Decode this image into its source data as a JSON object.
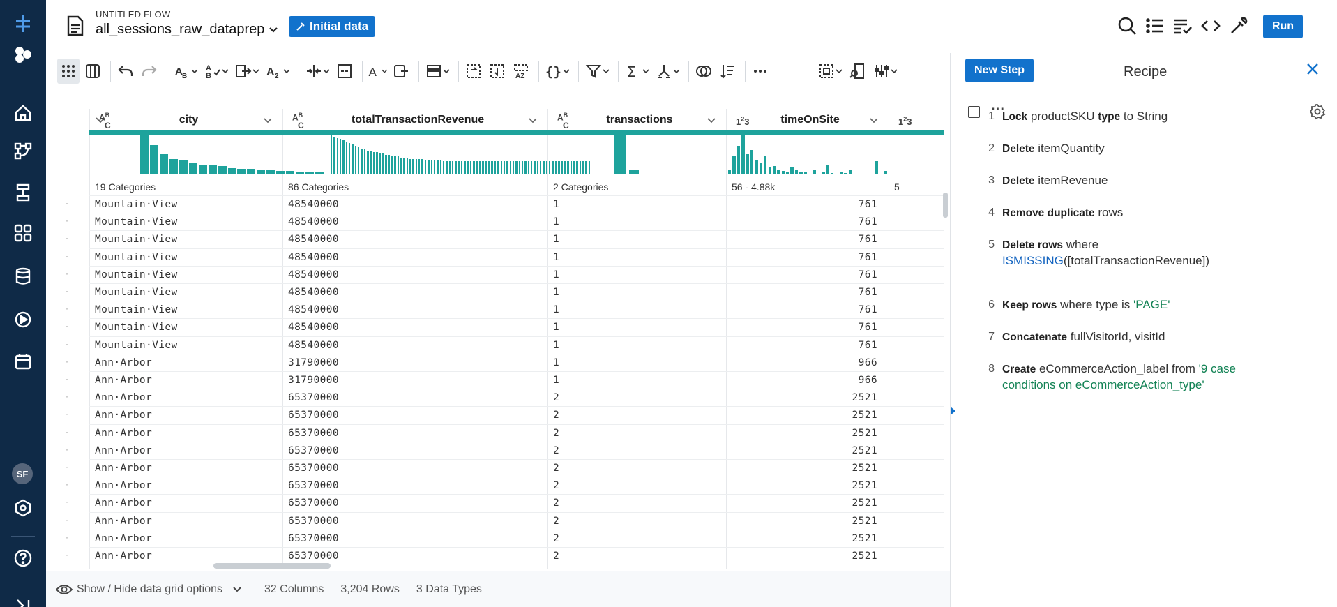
{
  "header": {
    "flow_label": "UNTITLED FLOW",
    "dataset_name": "all_sessions_raw_dataprep",
    "initial_data_label": "Initial data",
    "run_label": "Run"
  },
  "left_nav": {
    "avatar_initials": "SF",
    "icons": [
      "flow-logo-icon",
      "blocks-icon",
      "home-icon",
      "flows-icon",
      "plans-icon",
      "library-icon",
      "database-icon",
      "jobs-icon",
      "schedule-icon",
      "settings-hex-icon",
      "help-icon",
      "collapse-icon"
    ]
  },
  "columns": [
    {
      "type": "ABC",
      "name": "city",
      "summary": "19 Categories"
    },
    {
      "type": "ABC",
      "name": "totalTransactionRevenue",
      "summary": "86 Categories"
    },
    {
      "type": "ABC",
      "name": "transactions",
      "summary": "2 Categories"
    },
    {
      "type": "123",
      "name": "timeOnSite",
      "summary": "56 - 4.88k"
    },
    {
      "type": "123",
      "name": "",
      "summary": "5"
    }
  ],
  "histograms": {
    "city": [
      46,
      32,
      22,
      17,
      15,
      12,
      11,
      10,
      9,
      7,
      6,
      6,
      5,
      5,
      4,
      4,
      3,
      3,
      3
    ],
    "totalTransactionRevenue": [
      32,
      29,
      28,
      27,
      26,
      25,
      24,
      23,
      22,
      21,
      20,
      19,
      18,
      18,
      17,
      17,
      16,
      16,
      15,
      15,
      14,
      14,
      14,
      13,
      13,
      13,
      12,
      12,
      12,
      12,
      12,
      11,
      11,
      11,
      11,
      11,
      11,
      10,
      10,
      10,
      10,
      10,
      10,
      10,
      10,
      10,
      10,
      10,
      10,
      10,
      10,
      10,
      10,
      10,
      10,
      10,
      10,
      10,
      10,
      10,
      10,
      10,
      10,
      10,
      10,
      10,
      10,
      10,
      10,
      10,
      10,
      10,
      10,
      10,
      10,
      10,
      10,
      10,
      10,
      10,
      10,
      10,
      10,
      10,
      10,
      10
    ],
    "transactions": [
      48,
      5
    ],
    "timeOnSite": [
      6,
      26,
      40,
      58,
      28,
      34,
      19,
      16,
      25,
      10,
      12,
      7,
      5,
      3,
      10,
      7,
      4,
      4,
      0,
      6,
      0,
      3,
      13,
      2,
      0,
      3,
      2,
      6,
      0,
      0,
      0,
      0,
      0,
      18,
      0,
      5
    ]
  },
  "rows": [
    {
      "city": "Mountain·View",
      "revenue": "48540000",
      "transactions": "1",
      "timeOnSite": "761"
    },
    {
      "city": "Mountain·View",
      "revenue": "48540000",
      "transactions": "1",
      "timeOnSite": "761"
    },
    {
      "city": "Mountain·View",
      "revenue": "48540000",
      "transactions": "1",
      "timeOnSite": "761"
    },
    {
      "city": "Mountain·View",
      "revenue": "48540000",
      "transactions": "1",
      "timeOnSite": "761"
    },
    {
      "city": "Mountain·View",
      "revenue": "48540000",
      "transactions": "1",
      "timeOnSite": "761"
    },
    {
      "city": "Mountain·View",
      "revenue": "48540000",
      "transactions": "1",
      "timeOnSite": "761"
    },
    {
      "city": "Mountain·View",
      "revenue": "48540000",
      "transactions": "1",
      "timeOnSite": "761"
    },
    {
      "city": "Mountain·View",
      "revenue": "48540000",
      "transactions": "1",
      "timeOnSite": "761"
    },
    {
      "city": "Mountain·View",
      "revenue": "48540000",
      "transactions": "1",
      "timeOnSite": "761"
    },
    {
      "city": "Ann·Arbor",
      "revenue": "31790000",
      "transactions": "1",
      "timeOnSite": "966"
    },
    {
      "city": "Ann·Arbor",
      "revenue": "31790000",
      "transactions": "1",
      "timeOnSite": "966"
    },
    {
      "city": "Ann·Arbor",
      "revenue": "65370000",
      "transactions": "2",
      "timeOnSite": "2521"
    },
    {
      "city": "Ann·Arbor",
      "revenue": "65370000",
      "transactions": "2",
      "timeOnSite": "2521"
    },
    {
      "city": "Ann·Arbor",
      "revenue": "65370000",
      "transactions": "2",
      "timeOnSite": "2521"
    },
    {
      "city": "Ann·Arbor",
      "revenue": "65370000",
      "transactions": "2",
      "timeOnSite": "2521"
    },
    {
      "city": "Ann·Arbor",
      "revenue": "65370000",
      "transactions": "2",
      "timeOnSite": "2521"
    },
    {
      "city": "Ann·Arbor",
      "revenue": "65370000",
      "transactions": "2",
      "timeOnSite": "2521"
    },
    {
      "city": "Ann·Arbor",
      "revenue": "65370000",
      "transactions": "2",
      "timeOnSite": "2521"
    },
    {
      "city": "Ann·Arbor",
      "revenue": "65370000",
      "transactions": "2",
      "timeOnSite": "2521"
    },
    {
      "city": "Ann·Arbor",
      "revenue": "65370000",
      "transactions": "2",
      "timeOnSite": "2521"
    },
    {
      "city": "Ann·Arbor",
      "revenue": "65370000",
      "transactions": "2",
      "timeOnSite": "2521"
    }
  ],
  "footer": {
    "grid_options_label": "Show / Hide data grid options",
    "columns_count": "32 Columns",
    "rows_count": "3,204 Rows",
    "data_types": "3 Data Types"
  },
  "recipe": {
    "new_step_label": "New Step",
    "title": "Recipe",
    "steps": [
      {
        "num": "1",
        "parts": [
          {
            "k": "b",
            "t": "Lock"
          },
          {
            "k": "t",
            "t": " productSKU "
          },
          {
            "k": "b",
            "t": "type"
          },
          {
            "k": "t",
            "t": " to String"
          }
        ]
      },
      {
        "num": "2",
        "parts": [
          {
            "k": "b",
            "t": "Delete"
          },
          {
            "k": "t",
            "t": " itemQuantity"
          }
        ]
      },
      {
        "num": "3",
        "parts": [
          {
            "k": "b",
            "t": "Delete"
          },
          {
            "k": "t",
            "t": " itemRevenue"
          }
        ]
      },
      {
        "num": "4",
        "parts": [
          {
            "k": "b",
            "t": "Remove duplicate"
          },
          {
            "k": "t",
            "t": " rows"
          }
        ]
      },
      {
        "num": "5",
        "parts": [
          {
            "k": "b",
            "t": "Delete rows"
          },
          {
            "k": "t",
            "t": " where "
          },
          {
            "k": "fn",
            "t": "ISMISSING"
          },
          {
            "k": "t",
            "t": "([totalTransactionRevenue])"
          }
        ]
      },
      {
        "num": "6",
        "parts": [
          {
            "k": "b",
            "t": "Keep rows"
          },
          {
            "k": "t",
            "t": " where type is "
          },
          {
            "k": "str",
            "t": "'PAGE'"
          }
        ]
      },
      {
        "num": "7",
        "parts": [
          {
            "k": "b",
            "t": "Concatenate"
          },
          {
            "k": "t",
            "t": " fullVisitorId, visitId"
          }
        ]
      },
      {
        "num": "8",
        "parts": [
          {
            "k": "b",
            "t": "Create"
          },
          {
            "k": "t",
            "t": " eCommerceAction_label from "
          },
          {
            "k": "str",
            "t": "'9 case conditions on eCommerceAction_type'"
          }
        ]
      }
    ]
  },
  "colors": {
    "nav_bg": "#0f2a47",
    "accent": "#1272cc",
    "histogram": "#1ea39c"
  }
}
